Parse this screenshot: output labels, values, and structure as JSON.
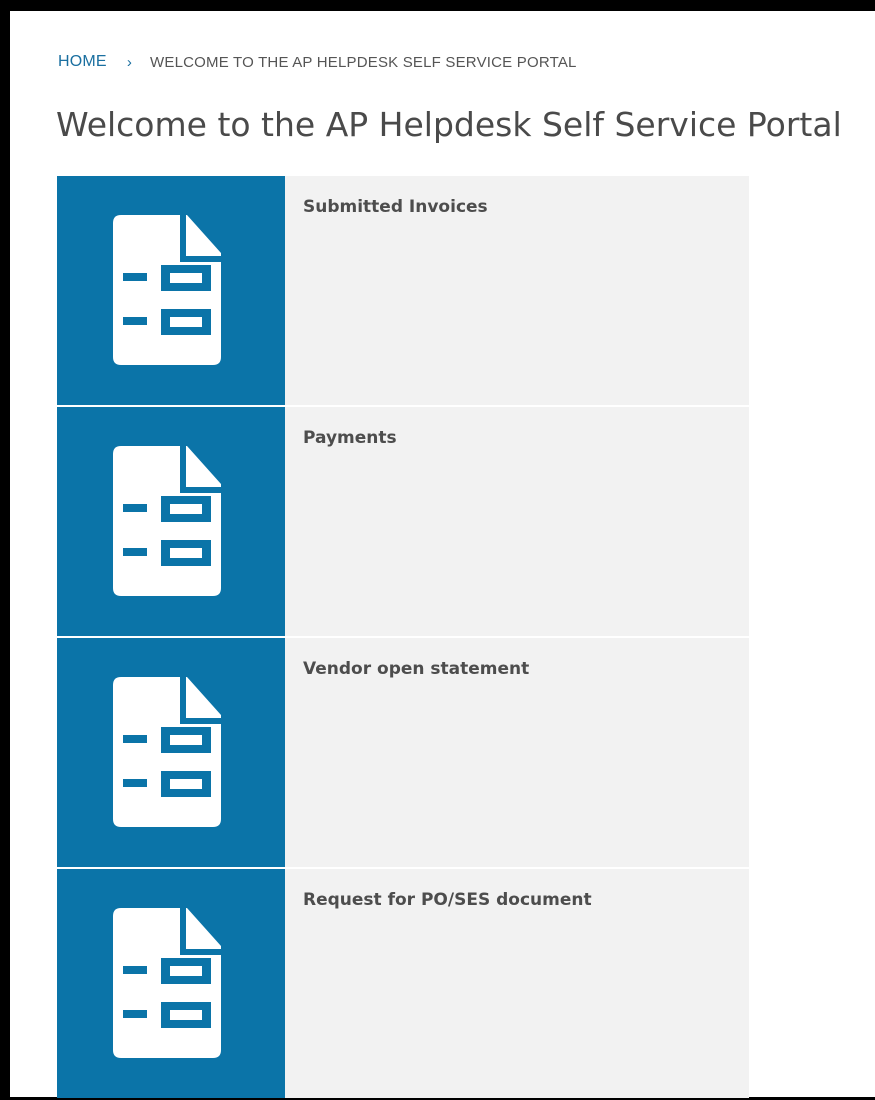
{
  "breadcrumb": {
    "home": "HOME",
    "separator": "›",
    "current": "WELCOME TO THE AP HELPDESK SELF SERVICE PORTAL"
  },
  "page_title": "Welcome to the AP Helpdesk Self Service Portal",
  "tiles": [
    {
      "label": "Submitted Invoices",
      "icon": "form-document-icon"
    },
    {
      "label": "Payments",
      "icon": "form-document-icon"
    },
    {
      "label": "Vendor open statement",
      "icon": "form-document-icon"
    },
    {
      "label": "Request for PO/SES document",
      "icon": "form-document-icon"
    }
  ],
  "colors": {
    "tile_accent": "#0b74a8",
    "tile_background": "#f2f2f2",
    "link": "#1a6fa0"
  }
}
